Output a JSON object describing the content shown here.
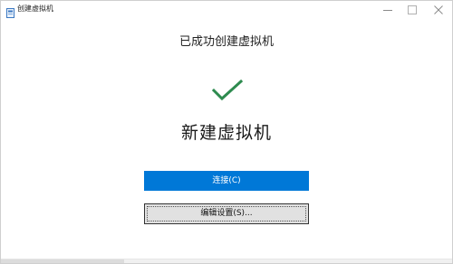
{
  "window": {
    "title": "创建虚拟机"
  },
  "content": {
    "success_message": "已成功创建虚拟机",
    "vm_name": "新建虚拟机"
  },
  "buttons": {
    "connect_label": "连接(C)",
    "edit_settings_label": "编辑设置(S)..."
  },
  "icons": {
    "app_icon": "hyperv-app-icon",
    "success_icon": "checkmark-icon",
    "minimize": "minimize-icon",
    "maximize": "maximize-icon",
    "close": "close-icon"
  },
  "colors": {
    "accent": "#0078d7",
    "success": "#2e8b4f",
    "secondary_button": "#e1e1e1"
  }
}
